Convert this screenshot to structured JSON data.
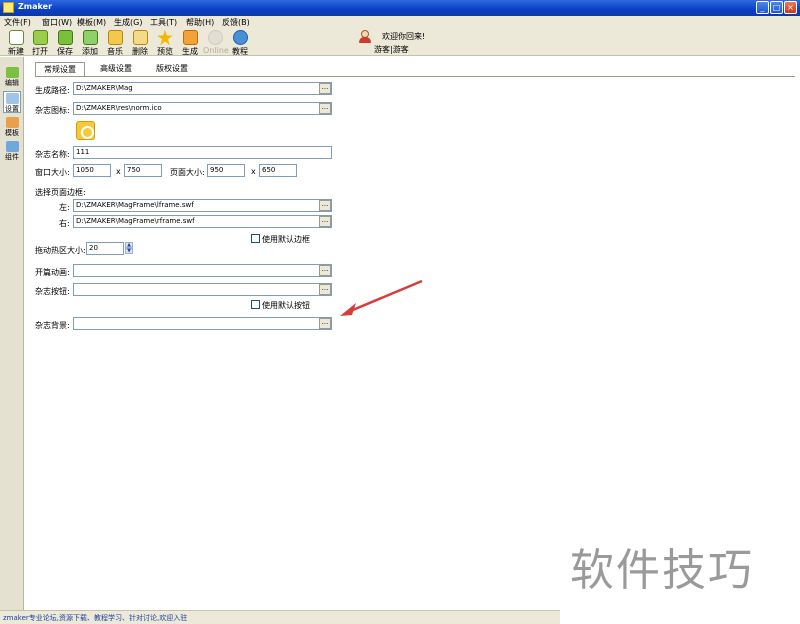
{
  "window": {
    "title": "Zmaker"
  },
  "menus": [
    "文件(F)",
    "窗口(W)",
    "模板(M)",
    "生成(G)",
    "工具(T)",
    "帮助(H)",
    "反馈(B)"
  ],
  "toolbar": {
    "new": "新建",
    "open": "打开",
    "save": "保存",
    "add": "添加",
    "music": "音乐",
    "delete": "删除",
    "preview": "预览",
    "generate": "生成",
    "online": "Online",
    "tutorial": "教程"
  },
  "welcome": {
    "message": "欢迎你回来!",
    "user": "游客|游客"
  },
  "sidebar": {
    "items": [
      "编辑",
      "设置",
      "模板",
      "组件"
    ]
  },
  "tabs": [
    "常规设置",
    "高级设置",
    "版权设置"
  ],
  "form": {
    "output_path": {
      "label": "生成路径:",
      "value": "D:\\ZMAKER\\Mag"
    },
    "mag_icon": {
      "label": "杂志图标:",
      "value": "D:\\ZMAKER\\res\\norm.ico"
    },
    "mag_name": {
      "label": "杂志名称:",
      "value": "111"
    },
    "window_size": {
      "label": "窗口大小:",
      "width": "1050",
      "height": "750"
    },
    "page_size": {
      "label": "页面大小:",
      "width": "950",
      "height": "650"
    },
    "separator": "x",
    "page_frame": {
      "label": "选择页面边框:",
      "left_label": "左:",
      "left_value": "D:\\ZMAKER\\MagFrame\\lframe.swf",
      "right_label": "右:",
      "right_value": "D:\\ZMAKER\\MagFrame\\rframe.swf",
      "default_label": "使用默认边框"
    },
    "drag_hotspot": {
      "label": "拖动热区大小:",
      "value": "20"
    },
    "opening_animation": {
      "label": "开篇动画:",
      "value": ""
    },
    "mag_buttons": {
      "label": "杂志按钮:",
      "value": "",
      "default_label": "使用默认按钮"
    },
    "mag_background": {
      "label": "杂志背景:",
      "value": ""
    },
    "browse_label": "..."
  },
  "status": {
    "text": "zmaker专业论坛,资源下载、教程学习、针对讨论,欢迎入驻"
  },
  "watermark": {
    "text": "软件技巧"
  },
  "colors": {
    "accent": "#0a3fc4",
    "arrow": "#d93a3a",
    "chrome": "#ece9d8"
  }
}
